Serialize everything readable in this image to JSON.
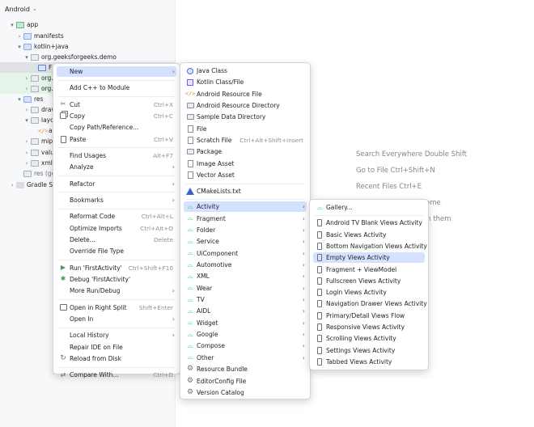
{
  "project": {
    "view_selector": "Android",
    "tree": [
      {
        "label": "app",
        "indent": 1,
        "arrow": "▾",
        "icon": "folder-green"
      },
      {
        "label": "manifests",
        "indent": 2,
        "arrow": "›",
        "icon": "folder-blue"
      },
      {
        "label": "kotlin+java",
        "indent": 2,
        "arrow": "▾",
        "icon": "folder-blue"
      },
      {
        "label": "org.geeksforgeeks.demo",
        "indent": 3,
        "arrow": "▾",
        "icon": "folder-grey"
      },
      {
        "label": "F",
        "indent": 4,
        "arrow": "",
        "icon": "class",
        "state": "selected"
      },
      {
        "label": "org.g",
        "indent": 3,
        "arrow": "›",
        "icon": "folder-grey",
        "state": "green"
      },
      {
        "label": "org.g",
        "indent": 3,
        "arrow": "›",
        "icon": "folder-grey",
        "state": "green"
      },
      {
        "label": "res",
        "indent": 2,
        "arrow": "▾",
        "icon": "folder-blue"
      },
      {
        "label": "draw",
        "indent": 3,
        "arrow": "›",
        "icon": "folder-grey"
      },
      {
        "label": "layo",
        "indent": 3,
        "arrow": "▾",
        "icon": "folder-grey"
      },
      {
        "label": "a",
        "indent": 4,
        "arrow": "",
        "icon": "xml"
      },
      {
        "label": "mipr",
        "indent": 3,
        "arrow": "›",
        "icon": "folder-grey"
      },
      {
        "label": "valu",
        "indent": 3,
        "arrow": "›",
        "icon": "folder-grey"
      },
      {
        "label": "xml",
        "indent": 3,
        "arrow": "›",
        "icon": "folder-grey"
      },
      {
        "label": "res (ge",
        "indent": 2,
        "arrow": "",
        "icon": "folder-grey"
      },
      {
        "label": "Gradle Scr",
        "indent": 1,
        "arrow": "›",
        "icon": "gradle"
      }
    ]
  },
  "editor_hints": [
    "Search Everywhere Double Shift",
    "Go to File Ctrl+Shift+N",
    "Recent Files Ctrl+E",
    "ome",
    "en them"
  ],
  "context_menu": {
    "items": [
      {
        "type": "item",
        "label": "New",
        "icon": "",
        "submenu": true,
        "active": true
      },
      {
        "type": "sep"
      },
      {
        "type": "item",
        "label": "Add C++ to Module",
        "icon": ""
      },
      {
        "type": "sep"
      },
      {
        "type": "item",
        "label": "Cut",
        "icon": "cut-icon",
        "shortcut": "Ctrl+X"
      },
      {
        "type": "item",
        "label": "Copy",
        "icon": "copy-icon",
        "shortcut": "Ctrl+C"
      },
      {
        "type": "item",
        "label": "Copy Path/Reference...",
        "icon": ""
      },
      {
        "type": "item",
        "label": "Paste",
        "icon": "paste-icon",
        "shortcut": "Ctrl+V"
      },
      {
        "type": "sep"
      },
      {
        "type": "item",
        "label": "Find Usages",
        "icon": "",
        "shortcut": "Alt+F7"
      },
      {
        "type": "item",
        "label": "Analyze",
        "icon": "",
        "submenu": true
      },
      {
        "type": "sep"
      },
      {
        "type": "item",
        "label": "Refactor",
        "icon": "",
        "submenu": true
      },
      {
        "type": "sep"
      },
      {
        "type": "item",
        "label": "Bookmarks",
        "icon": "",
        "submenu": true
      },
      {
        "type": "sep"
      },
      {
        "type": "item",
        "label": "Reformat Code",
        "icon": "",
        "shortcut": "Ctrl+Alt+L"
      },
      {
        "type": "item",
        "label": "Optimize Imports",
        "icon": "",
        "shortcut": "Ctrl+Alt+O"
      },
      {
        "type": "item",
        "label": "Delete...",
        "icon": "",
        "shortcut": "Delete"
      },
      {
        "type": "item",
        "label": "Override File Type",
        "icon": ""
      },
      {
        "type": "sep"
      },
      {
        "type": "item",
        "label": "Run 'FirstActivity'",
        "icon": "run-icon",
        "shortcut": "Ctrl+Shift+F10"
      },
      {
        "type": "item",
        "label": "Debug 'FirstActivity'",
        "icon": "debug-icon"
      },
      {
        "type": "item",
        "label": "More Run/Debug",
        "icon": "",
        "submenu": true
      },
      {
        "type": "sep"
      },
      {
        "type": "item",
        "label": "Open in Right Split",
        "icon": "split-icon",
        "shortcut": "Shift+Enter"
      },
      {
        "type": "item",
        "label": "Open In",
        "icon": "",
        "submenu": true
      },
      {
        "type": "sep"
      },
      {
        "type": "item",
        "label": "Local History",
        "icon": "",
        "submenu": true
      },
      {
        "type": "item",
        "label": "Repair IDE on File",
        "icon": ""
      },
      {
        "type": "item",
        "label": "Reload from Disk",
        "icon": "reload-icon"
      },
      {
        "type": "sep"
      },
      {
        "type": "item",
        "label": "Compare With...",
        "icon": "compare-icon",
        "shortcut": "Ctrl+D"
      }
    ]
  },
  "new_menu": {
    "items": [
      {
        "type": "item",
        "label": "Java Class",
        "icon": "java-class-icon"
      },
      {
        "type": "item",
        "label": "Kotlin Class/File",
        "icon": "kotlin-icon"
      },
      {
        "type": "item",
        "label": "Android Resource File",
        "icon": "resource-file-icon"
      },
      {
        "type": "item",
        "label": "Android Resource Directory",
        "icon": "directory-icon"
      },
      {
        "type": "item",
        "label": "Sample Data Directory",
        "icon": "directory-icon"
      },
      {
        "type": "item",
        "label": "File",
        "icon": "file-icon"
      },
      {
        "type": "item",
        "label": "Scratch File",
        "icon": "file-icon",
        "shortcut": "Ctrl+Alt+Shift+Insert"
      },
      {
        "type": "item",
        "label": "Package",
        "icon": "directory-icon"
      },
      {
        "type": "item",
        "label": "Image Asset",
        "icon": "file-icon"
      },
      {
        "type": "item",
        "label": "Vector Asset",
        "icon": "file-icon"
      },
      {
        "type": "sep"
      },
      {
        "type": "item",
        "label": "CMakeLists.txt",
        "icon": "cmake-icon"
      },
      {
        "type": "sep"
      },
      {
        "type": "item",
        "label": "Activity",
        "icon": "android-icon",
        "submenu": true,
        "active": true
      },
      {
        "type": "item",
        "label": "Fragment",
        "icon": "android-icon",
        "submenu": true
      },
      {
        "type": "item",
        "label": "Folder",
        "icon": "android-icon",
        "submenu": true
      },
      {
        "type": "item",
        "label": "Service",
        "icon": "android-icon",
        "submenu": true
      },
      {
        "type": "item",
        "label": "UiComponent",
        "icon": "android-icon",
        "submenu": true
      },
      {
        "type": "item",
        "label": "Automotive",
        "icon": "android-icon",
        "submenu": true
      },
      {
        "type": "item",
        "label": "XML",
        "icon": "android-icon",
        "submenu": true
      },
      {
        "type": "item",
        "label": "Wear",
        "icon": "android-icon",
        "submenu": true
      },
      {
        "type": "item",
        "label": "TV",
        "icon": "android-icon",
        "submenu": true
      },
      {
        "type": "item",
        "label": "AIDL",
        "icon": "android-icon",
        "submenu": true
      },
      {
        "type": "item",
        "label": "Widget",
        "icon": "android-icon",
        "submenu": true
      },
      {
        "type": "item",
        "label": "Google",
        "icon": "android-icon",
        "submenu": true
      },
      {
        "type": "item",
        "label": "Compose",
        "icon": "android-icon",
        "submenu": true
      },
      {
        "type": "item",
        "label": "Other",
        "icon": "android-icon",
        "submenu": true
      },
      {
        "type": "item",
        "label": "Resource Bundle",
        "icon": "gear-icon"
      },
      {
        "type": "item",
        "label": "EditorConfig File",
        "icon": "gear-icon"
      },
      {
        "type": "item",
        "label": "Version Catalog",
        "icon": "gear-icon"
      }
    ]
  },
  "activity_menu": {
    "items": [
      {
        "type": "item",
        "label": "Gallery...",
        "icon": "android-icon"
      },
      {
        "type": "sep"
      },
      {
        "type": "item",
        "label": "Android TV Blank Views Activity",
        "icon": "phone-icon"
      },
      {
        "type": "item",
        "label": "Basic Views Activity",
        "icon": "phone-icon"
      },
      {
        "type": "item",
        "label": "Bottom Navigation Views Activity",
        "icon": "phone-icon"
      },
      {
        "type": "item",
        "label": "Empty Views Activity",
        "icon": "phone-icon",
        "active": true
      },
      {
        "type": "item",
        "label": "Fragment + ViewModel",
        "icon": "phone-icon"
      },
      {
        "type": "item",
        "label": "Fullscreen Views Activity",
        "icon": "phone-icon"
      },
      {
        "type": "item",
        "label": "Login Views Activity",
        "icon": "phone-icon"
      },
      {
        "type": "item",
        "label": "Navigation Drawer Views Activity",
        "icon": "phone-icon"
      },
      {
        "type": "item",
        "label": "Primary/Detail Views Flow",
        "icon": "phone-icon"
      },
      {
        "type": "item",
        "label": "Responsive Views Activity",
        "icon": "phone-icon"
      },
      {
        "type": "item",
        "label": "Scrolling Views Activity",
        "icon": "phone-icon"
      },
      {
        "type": "item",
        "label": "Settings Views Activity",
        "icon": "phone-icon"
      },
      {
        "type": "item",
        "label": "Tabbed Views Activity",
        "icon": "phone-icon"
      }
    ]
  }
}
